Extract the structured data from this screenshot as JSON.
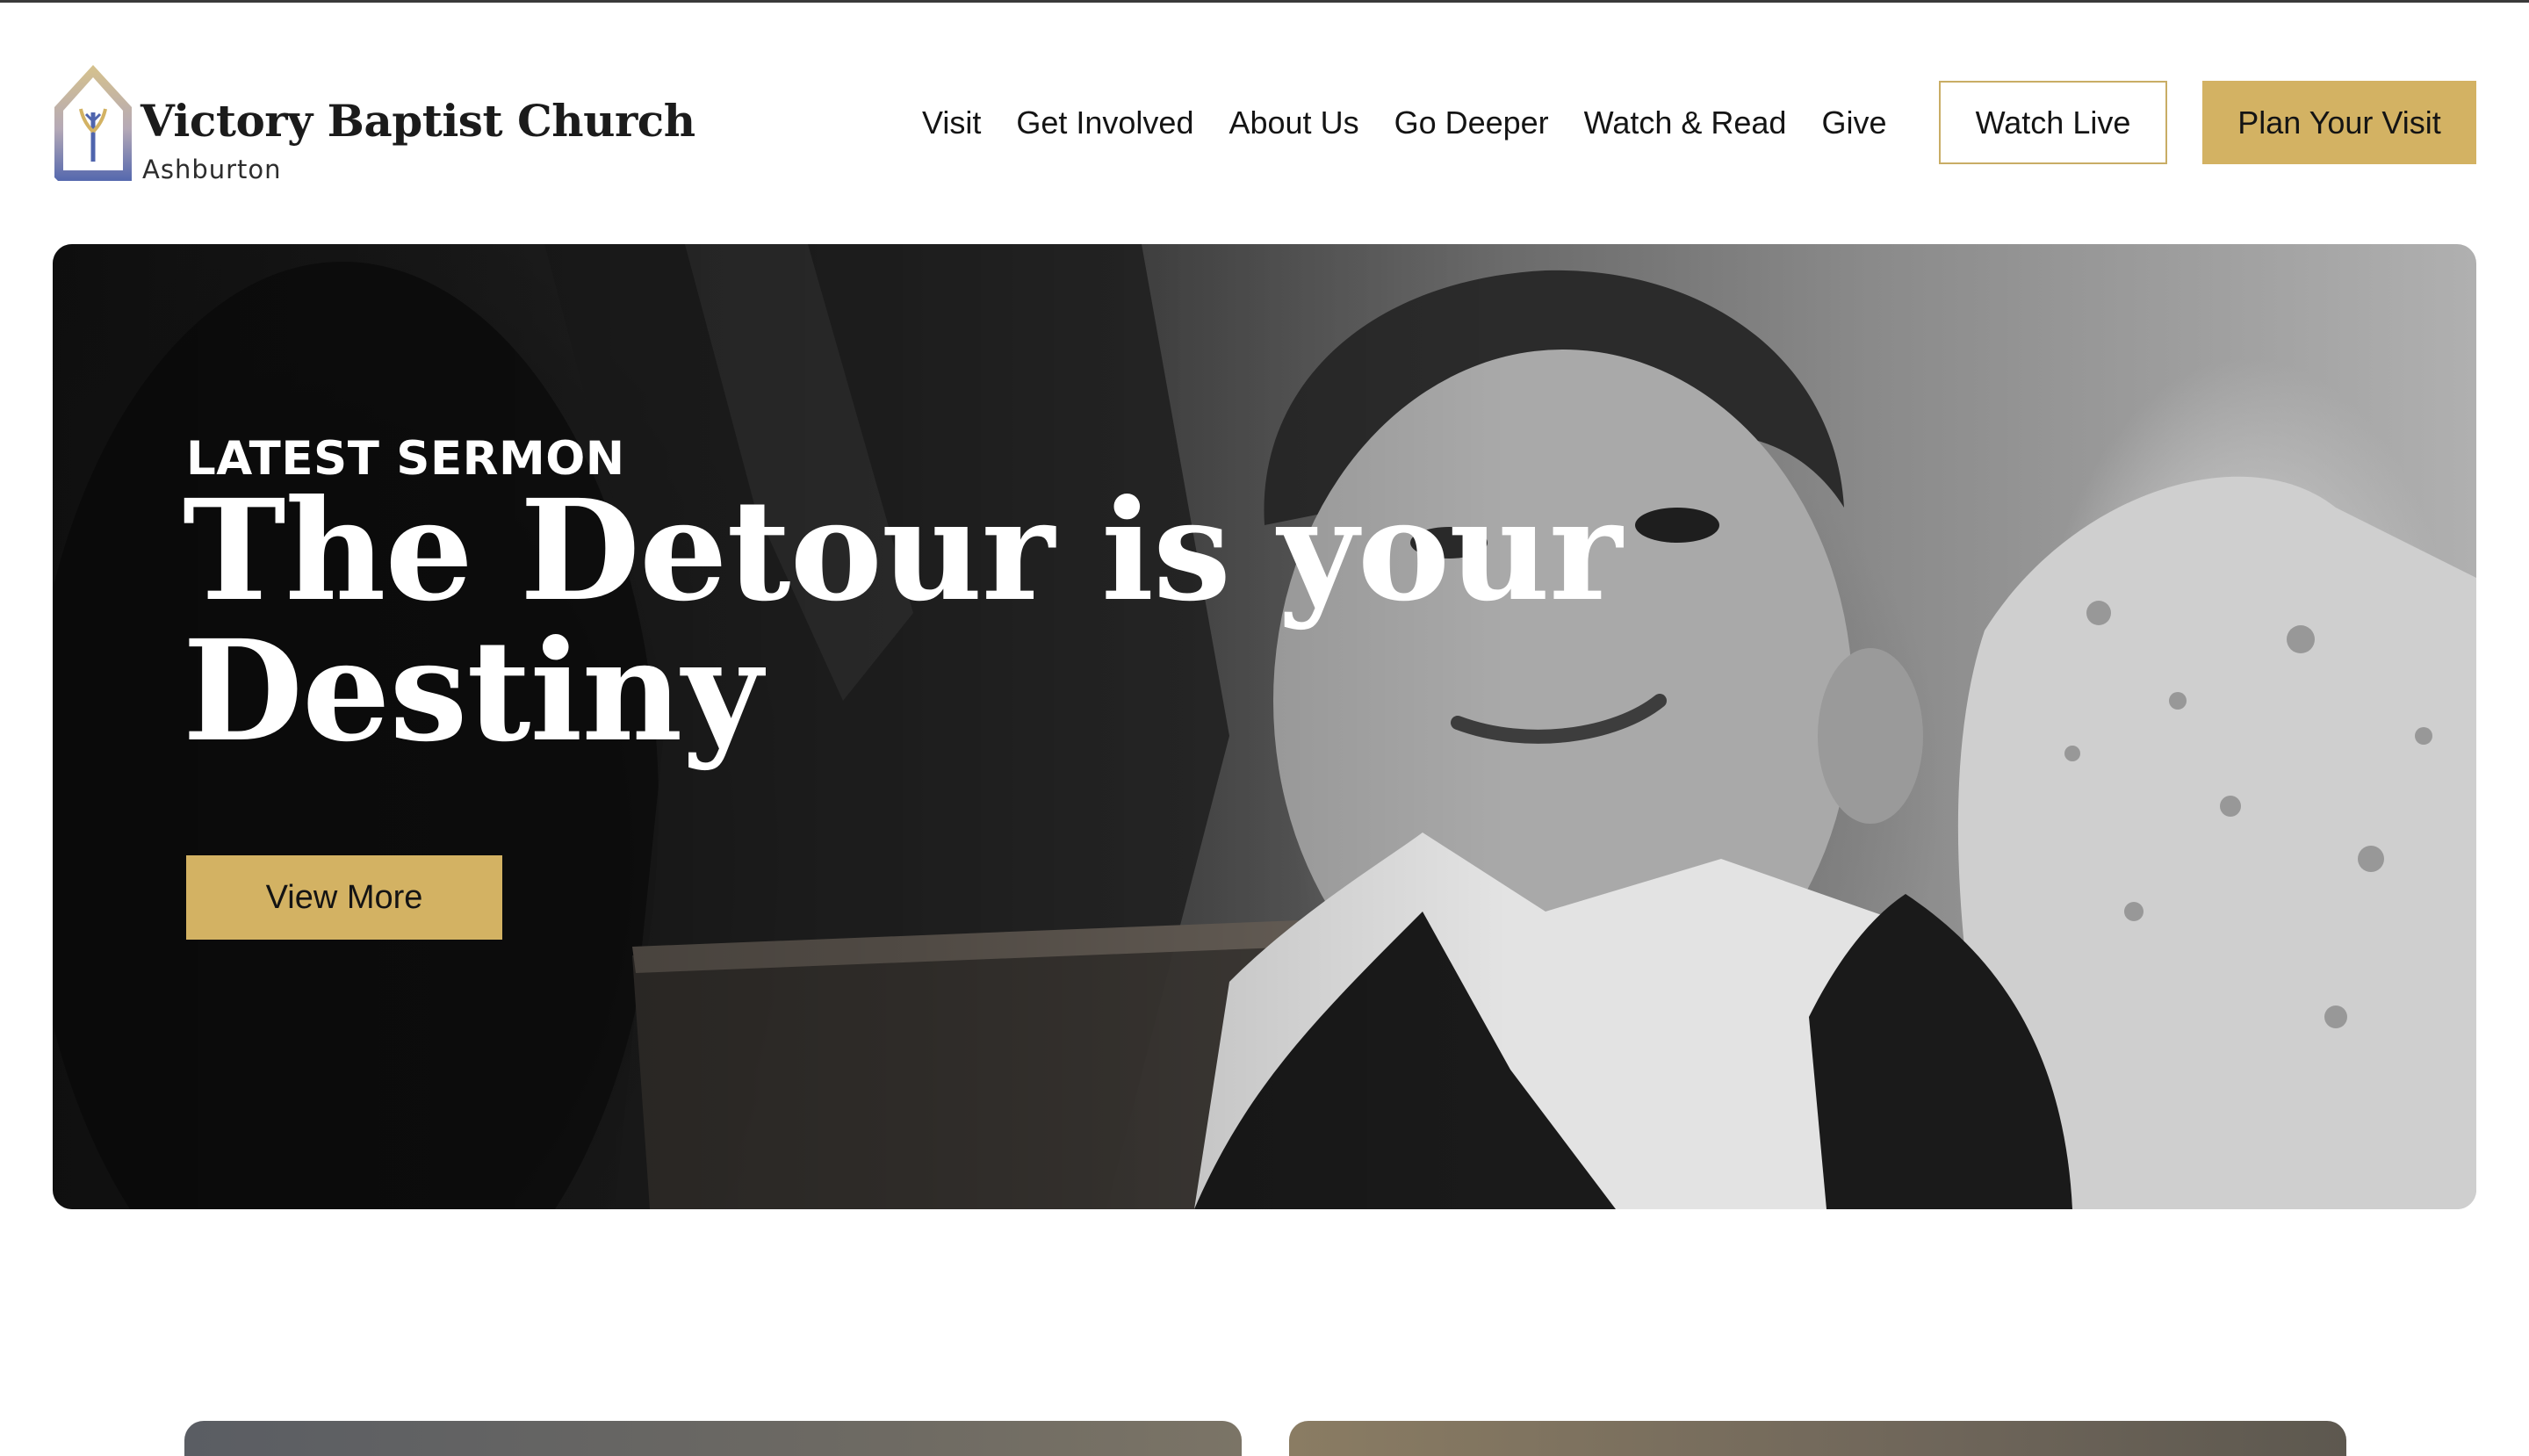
{
  "brand": {
    "name": "Victory Baptist Church",
    "location": "Ashburton",
    "colors": {
      "gold": "#d3b263",
      "gold_border": "#c9ad65",
      "logo_blue": "#5a6fb0"
    }
  },
  "nav": {
    "items": [
      {
        "label": "Visit"
      },
      {
        "label": "Get Involved"
      },
      {
        "label": "About Us"
      },
      {
        "label": "Go Deeper"
      },
      {
        "label": "Watch & Read"
      },
      {
        "label": "Give"
      }
    ],
    "watch_live": "Watch Live",
    "plan_visit": "Plan Your Visit"
  },
  "hero": {
    "kicker": "LATEST SERMON",
    "title": "The Detour is your Destiny",
    "cta": "View More",
    "image": "black-and-white-photo-of-smiling-boy-in-church-pews"
  }
}
